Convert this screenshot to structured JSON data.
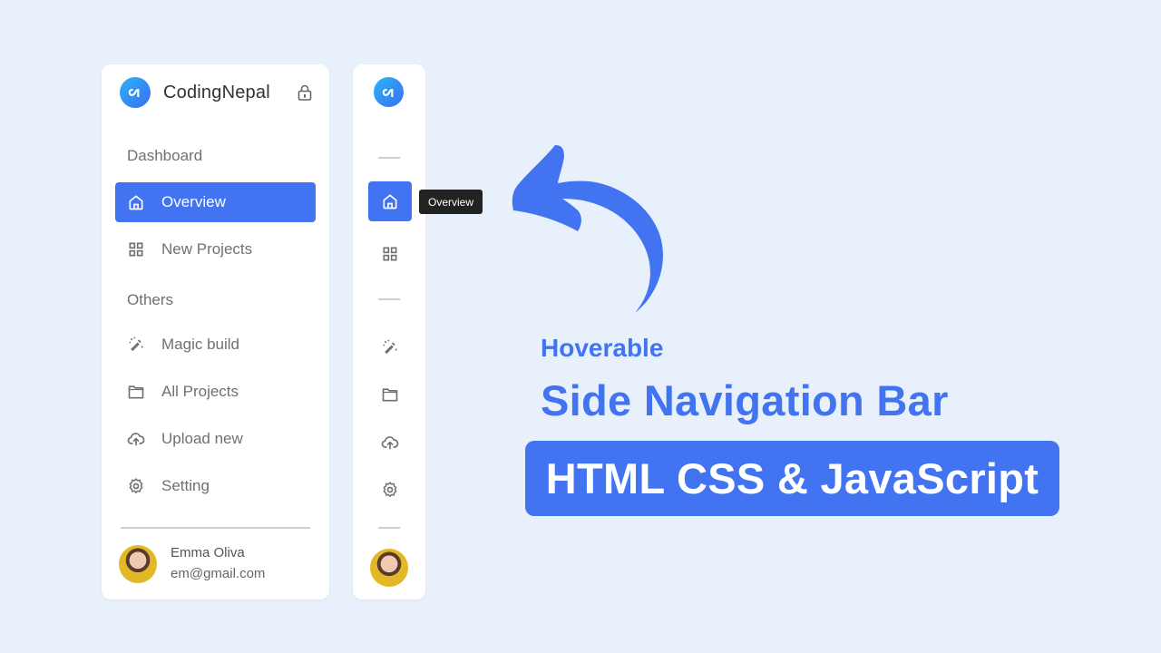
{
  "brand": {
    "name": "CodingNepal",
    "accent": "#4273f1"
  },
  "sidebar": {
    "sections": [
      {
        "label": "Dashboard"
      },
      {
        "label": "Others"
      }
    ],
    "items": [
      {
        "label": "Overview",
        "icon": "home-icon",
        "active": true
      },
      {
        "label": "New Projects",
        "icon": "grid-icon",
        "active": false
      },
      {
        "label": "Magic build",
        "icon": "magic-wand-icon",
        "active": false
      },
      {
        "label": "All Projects",
        "icon": "folder-icon",
        "active": false
      },
      {
        "label": "Upload new",
        "icon": "cloud-upload-icon",
        "active": false
      },
      {
        "label": "Setting",
        "icon": "gear-icon",
        "active": false
      }
    ],
    "user": {
      "name": "Emma Oliva",
      "email": "em@gmail.com"
    }
  },
  "collapsed_sidebar": {
    "tooltip": "Overview"
  },
  "headline": {
    "kicker": "Hoverable",
    "title": "Side Navigation Bar",
    "banner": "HTML CSS & JavaScript"
  }
}
